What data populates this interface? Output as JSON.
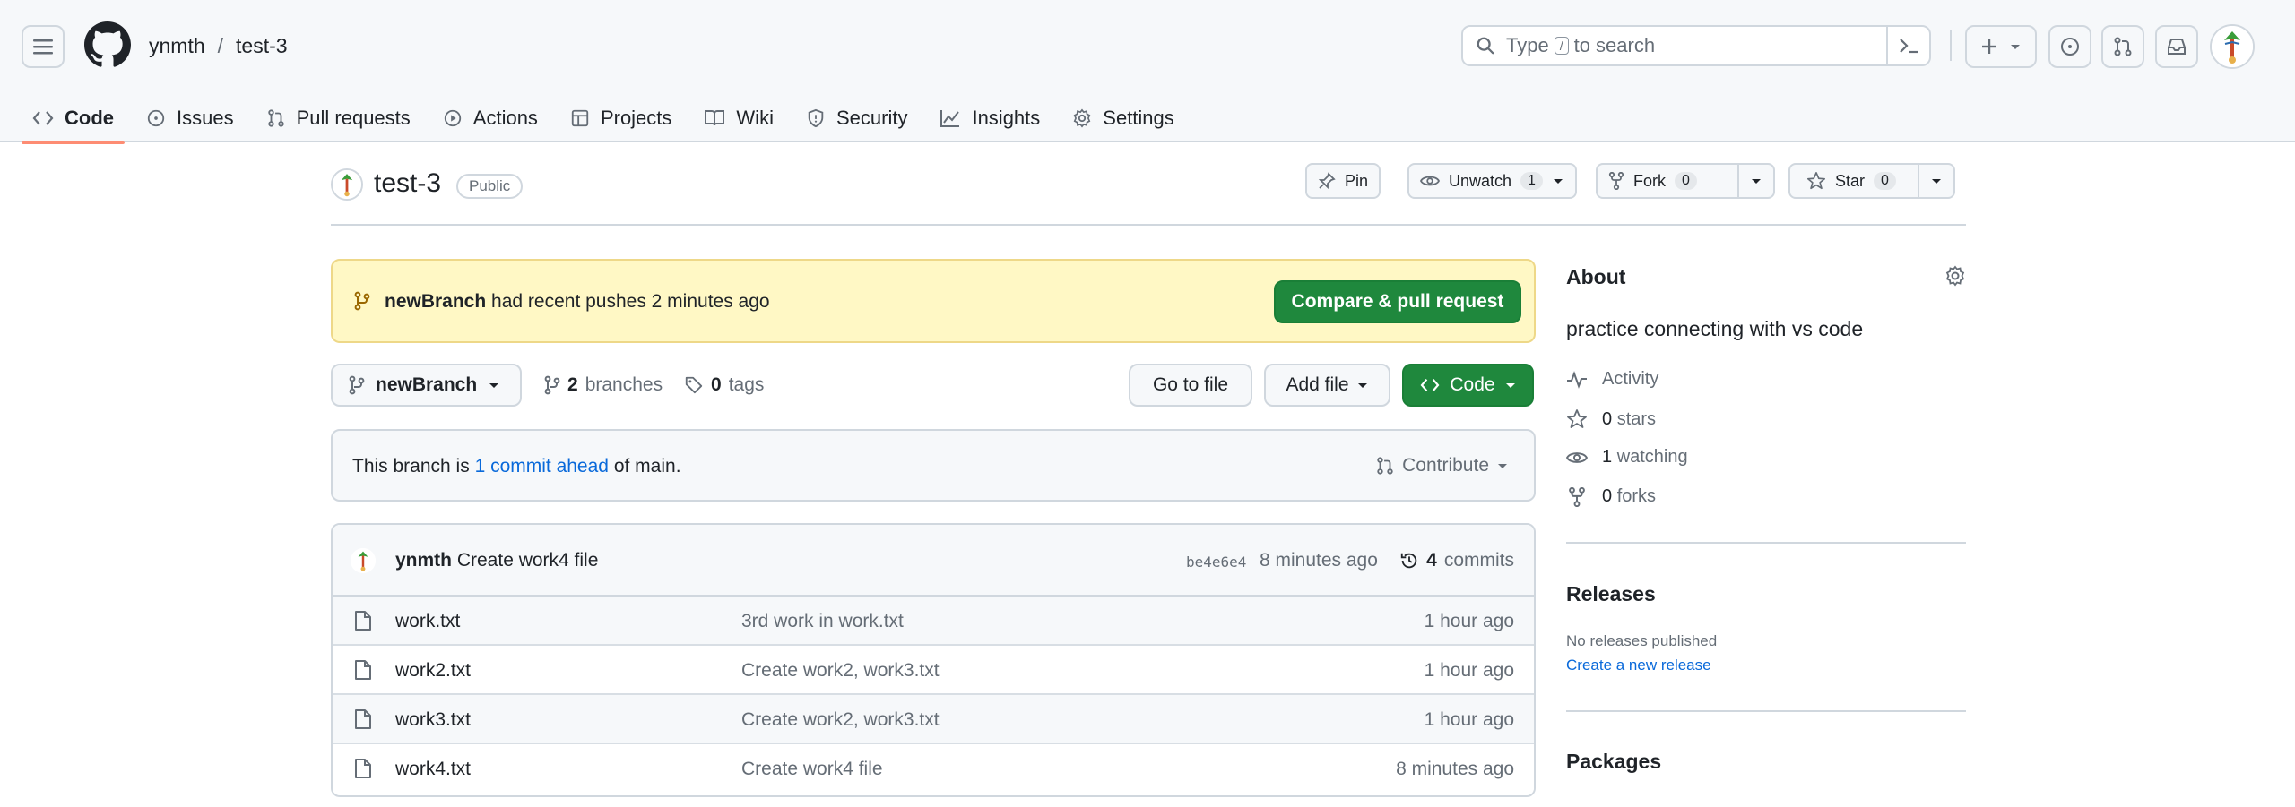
{
  "breadcrumb": {
    "owner": "ynmth",
    "separator": "/",
    "repo": "test-3"
  },
  "search": {
    "placeholder_pre": "Type",
    "slash_key": "/",
    "placeholder_post": "to search"
  },
  "tabs": [
    {
      "label": "Code",
      "icon": "code-icon",
      "active": true
    },
    {
      "label": "Issues",
      "icon": "issue-icon"
    },
    {
      "label": "Pull requests",
      "icon": "pull-request-icon"
    },
    {
      "label": "Actions",
      "icon": "play-icon"
    },
    {
      "label": "Projects",
      "icon": "table-icon"
    },
    {
      "label": "Wiki",
      "icon": "book-icon"
    },
    {
      "label": "Security",
      "icon": "shield-icon"
    },
    {
      "label": "Insights",
      "icon": "graph-icon"
    },
    {
      "label": "Settings",
      "icon": "gear-icon"
    }
  ],
  "repo": {
    "name": "test-3",
    "visibility": "Public",
    "pin_label": "Pin",
    "watch_label": "Unwatch",
    "watch_count": "1",
    "fork_label": "Fork",
    "fork_count": "0",
    "star_label": "Star",
    "star_count": "0"
  },
  "banner": {
    "branch": "newBranch",
    "text": "had recent pushes 2 minutes ago",
    "button": "Compare & pull request"
  },
  "branchbar": {
    "current_branch": "newBranch",
    "branches_count": "2",
    "branches_label": "branches",
    "tags_count": "0",
    "tags_label": "tags",
    "goto_label": "Go to file",
    "addfile_label": "Add file",
    "code_label": "Code"
  },
  "ahead": {
    "prefix": "This branch is",
    "link": "1 commit ahead",
    "suffix": "of main.",
    "contribute": "Contribute"
  },
  "latest_commit": {
    "author": "ynmth",
    "message": "Create work4 file",
    "sha": "be4e6e4",
    "ago": "8 minutes ago",
    "commits_count": "4",
    "commits_label": "commits"
  },
  "files": [
    {
      "name": "work.txt",
      "message": "3rd work in work.txt",
      "ago": "1 hour ago"
    },
    {
      "name": "work2.txt",
      "message": "Create work2, work3.txt",
      "ago": "1 hour ago"
    },
    {
      "name": "work3.txt",
      "message": "Create work2, work3.txt",
      "ago": "1 hour ago"
    },
    {
      "name": "work4.txt",
      "message": "Create work4 file",
      "ago": "8 minutes ago"
    }
  ],
  "about": {
    "title": "About",
    "description": "practice connecting with vs code",
    "activity": "Activity",
    "stars_count": "0",
    "stars_label": "stars",
    "watching_count": "1",
    "watching_label": "watching",
    "forks_count": "0",
    "forks_label": "forks"
  },
  "releases": {
    "title": "Releases",
    "empty": "No releases published",
    "create_link": "Create a new release"
  },
  "packages": {
    "title": "Packages"
  }
}
